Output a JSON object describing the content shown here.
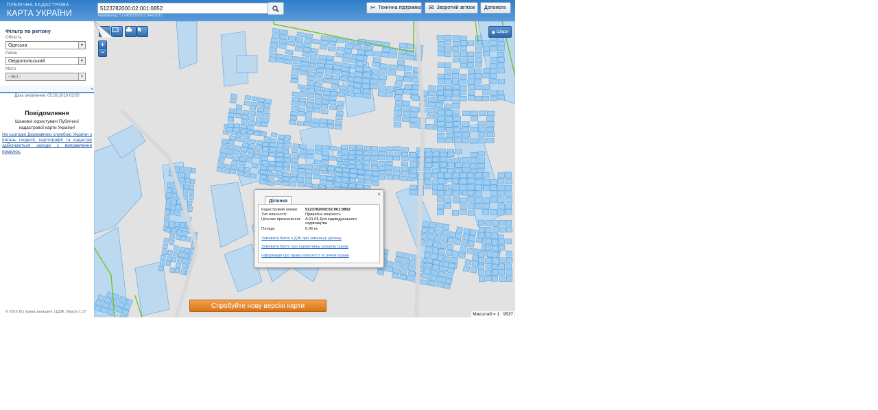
{
  "header": {
    "logo_line1": "ПУБЛІЧНА КАДАСТРОВА",
    "logo_line2": "КАРТА УКРАЇНИ",
    "search_value": "5123782000:02:001:0852",
    "example_text": "Наприклад: 5124583300:01:044:0010",
    "buttons": {
      "support": "Технічна підтримка",
      "feedback": "Зворотній зв'язок",
      "help": "Допомога"
    }
  },
  "sidebar": {
    "filter_title": "Фільтр по регіону",
    "oblast_label": "Область",
    "oblast_value": "Одеська",
    "raion_label": "Район",
    "raion_value": "Овідіопольський",
    "city_label": "Місто",
    "city_value": "- Всі -",
    "update_date": "Дата оновлення: 05.09.2019 03:00",
    "notice_title": "Повідомлення",
    "notice_greeting": "Шановні користувачі Публічної кадастрової карти України!",
    "notice_body": "На сьогодні Державною службою України з питань геодезії, картографії та кадастру здійснюються заходи з виправлення помилок.",
    "copyright": "© 2016 Всі права захищені, ЦДЗК. Версія 1.17"
  },
  "map": {
    "layers_label": "Шари",
    "zoom_in": "+",
    "zoom_out": "-",
    "new_version": "Спробуйте нову версію карти",
    "scale": "Масштаб = 1 : 9537"
  },
  "popup": {
    "tab": "Ділянка",
    "close": "×",
    "rows": [
      {
        "label": "Кадастровий номер:",
        "value": "5123782000:02:001:0852"
      },
      {
        "label": "Тип власності:",
        "value": "Приватна власність"
      },
      {
        "label": "Цільове призначення:",
        "value": "А.01.05 Для індивідуального садівництва"
      },
      {
        "label": "Площа:",
        "value": "0.06 га"
      }
    ],
    "links": [
      "Замовити Витяг з ДЗК про земельну ділянку",
      "Замовити Витяг про нормативну грошову оцінку",
      "Інформація про право власності та речові права"
    ]
  },
  "colors": {
    "header_accent": "#2f7dc9",
    "parcel_fill": "#9fcdf0",
    "parcel_stroke": "#4a9be0",
    "boundary_green": "#6cc230",
    "new_version_orange": "#e5862b"
  }
}
